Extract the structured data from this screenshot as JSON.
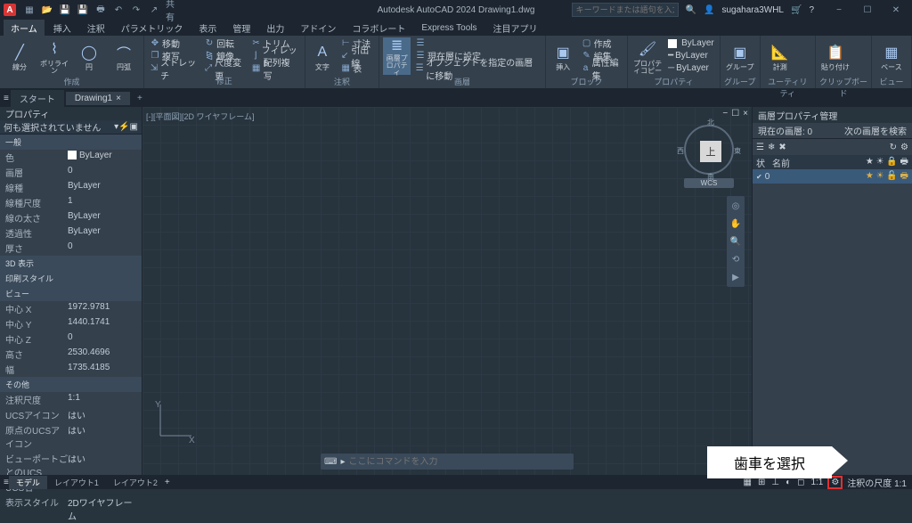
{
  "title": "Autodesk AutoCAD 2024  Drawing1.dwg",
  "qat_share": "共有",
  "search_placeholder": "キーワードまたは語句を入力",
  "username": "sugahara3WHL",
  "menu": {
    "home": "ホーム",
    "insert": "挿入",
    "annotate": "注釈",
    "parametric": "パラメトリック",
    "view": "表示",
    "manage": "管理",
    "output": "出力",
    "addins": "アドイン",
    "collab": "コラボレート",
    "express": "Express Tools",
    "featured": "注目アプリ"
  },
  "ribbon": {
    "draw": {
      "line": "線分",
      "polyline": "ポリライン",
      "circle": "円",
      "arc": "円弧",
      "label": "作成"
    },
    "modify": {
      "move": "移動",
      "rotate": "回転",
      "trim": "トリム",
      "copy": "複写",
      "mirror": "鏡像",
      "fillet": "フィレット",
      "stretch": "ストレッチ",
      "scale": "尺度変更",
      "array": "配列複写",
      "label": "修正"
    },
    "annot": {
      "text": "文字",
      "dim": "寸法",
      "leader": "引出線",
      "table": "表",
      "label": "注釈"
    },
    "layers": {
      "prop": "画層プロパティ",
      "btn1": "オブジェクトを指定の画層に移動",
      "btn2": "現在層に設定",
      "label": "画層"
    },
    "block": {
      "insert": "挿入",
      "edit": "編集",
      "attrib": "属性編集",
      "create": "作成",
      "label": "ブロック"
    },
    "props": {
      "bylayer": "ByLayer",
      "match": "プロパティコピー",
      "label": "プロパティ"
    },
    "group": {
      "g": "グループ",
      "label": "グループ"
    },
    "util": {
      "meas": "計測",
      "label": "ユーティリティ"
    },
    "clip": {
      "paste": "貼り付け",
      "label": "クリップボード"
    },
    "view": {
      "base": "ベース",
      "label": "ビュー"
    }
  },
  "filetabs": {
    "start": "スタート",
    "drawing": "Drawing1"
  },
  "props": {
    "title": "プロパティ",
    "nosel": "何も選択されていません",
    "s_general": "一般",
    "color_k": "色",
    "color_v": "ByLayer",
    "layer_k": "画層",
    "layer_v": "0",
    "ltype_k": "線種",
    "ltype_v": "ByLayer",
    "ltscale_k": "線種尺度",
    "ltscale_v": "1",
    "lweight_k": "線の太さ",
    "lweight_v": "ByLayer",
    "transp_k": "透過性",
    "transp_v": "ByLayer",
    "thick_k": "厚さ",
    "thick_v": "0",
    "s_3d": "3D 表示",
    "s_plot": "印刷スタイル",
    "s_view": "ビュー",
    "cx_k": "中心 X",
    "cx_v": "1972.9781",
    "cy_k": "中心 Y",
    "cy_v": "1440.1741",
    "cz_k": "中心 Z",
    "cz_v": "0",
    "h_k": "高さ",
    "h_v": "2530.4696",
    "w_k": "幅",
    "w_v": "1735.4185",
    "s_misc": "その他",
    "ascale_k": "注釈尺度",
    "ascale_v": "1:1",
    "ucsicon_k": "UCSアイコン",
    "ucsicon_v": "はい",
    "ucsorig_k": "原点のUCSアイコン",
    "ucsorig_v": "はい",
    "ucsvp_k": "ビューポートごとのUCS",
    "ucsvp_v": "はい",
    "ucsname_k": "UCS名",
    "ucsname_v": "",
    "vstyle_k": "表示スタイル",
    "vstyle_v": "2Dワイヤフレーム"
  },
  "canvas": {
    "viewlabel": "[-][平面図][2D ワイヤフレーム]",
    "cube_top": "上",
    "cube_n": "北",
    "cube_s": "南",
    "cube_e": "東",
    "cube_w": "西",
    "wcs": "WCS",
    "cmd_placeholder": "ここにコマンドを入力"
  },
  "layers": {
    "title": "画層プロパティ管理",
    "search": "次の画層を検索",
    "current": "現在の画層: 0",
    "col_status": "状",
    "col_name": "名前",
    "row0": "0"
  },
  "bottom": {
    "model": "モデル",
    "layout1": "レイアウト1",
    "layout2": "レイアウト2",
    "scale": "1:1",
    "anno": "注釈の尺度 1:1"
  },
  "callout": "歯車を選択"
}
